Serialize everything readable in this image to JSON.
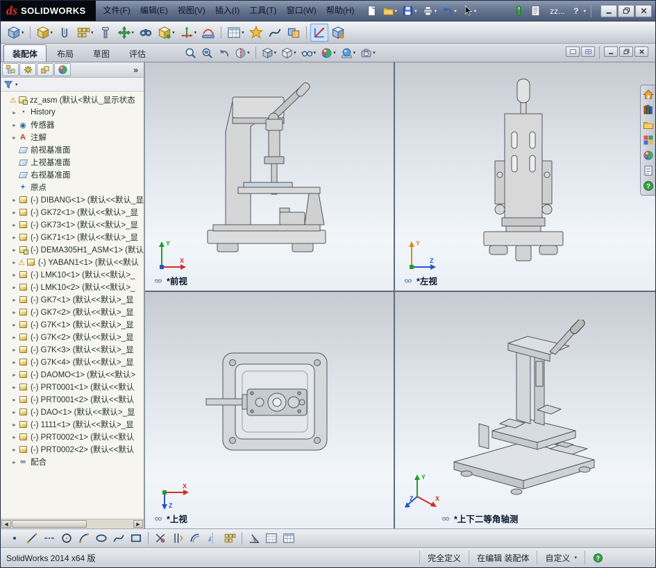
{
  "titlebar": {
    "logo": {
      "ds": "ds",
      "brand": "SOLIDWORKS"
    },
    "menus": [
      "文件(F)",
      "编辑(E)",
      "视图(V)",
      "插入(I)",
      "工具(T)",
      "窗口(W)",
      "帮助(H)"
    ],
    "icons": [
      {
        "n": "new-document-icon",
        "t": "sheet"
      },
      {
        "n": "open-icon",
        "t": "folder",
        "dd": true
      },
      {
        "n": "save-icon",
        "t": "disk",
        "dd": true
      },
      {
        "n": "print-icon",
        "t": "printer",
        "dd": true
      },
      {
        "n": "undo-icon",
        "t": "undo",
        "dd": true
      },
      {
        "n": "select-icon",
        "t": "cursor",
        "dd": true
      }
    ],
    "right_icons": [
      {
        "n": "rebuild-icon",
        "t": "rebuild"
      },
      {
        "n": "file-properties-icon",
        "t": "props"
      }
    ],
    "doc_short": "zz...",
    "help_label": "?",
    "window_buttons": [
      {
        "n": "minimize-icon",
        "t": "winmin"
      },
      {
        "n": "restore-icon",
        "t": "winrestore"
      },
      {
        "n": "close-icon",
        "t": "winclose"
      }
    ]
  },
  "toolbar": {
    "icons": [
      {
        "n": "edit-component-icon",
        "t": "cubeB",
        "dd": true
      },
      {
        "sep": true
      },
      {
        "n": "insert-components-icon",
        "t": "cubeY",
        "dd": true
      },
      {
        "n": "mate-icon",
        "t": "clip"
      },
      {
        "n": "linear-component-pattern-icon",
        "t": "pattern",
        "dd": true
      },
      {
        "n": "smart-fasteners-icon",
        "t": "screw"
      },
      {
        "n": "move-component-icon",
        "t": "move",
        "dd": true
      },
      {
        "n": "show-hidden-components-icon",
        "t": "binoc"
      },
      {
        "n": "assembly-features-icon",
        "t": "cubeY2",
        "dd": true
      },
      {
        "n": "reference-geometry-icon",
        "t": "axis",
        "dd": true
      },
      {
        "n": "new-motion-study-icon",
        "t": "motion"
      },
      {
        "sep": true
      },
      {
        "n": "bill-of-materials-icon",
        "t": "table",
        "dd": true
      },
      {
        "n": "exploded-view-icon",
        "t": "burst"
      },
      {
        "n": "explode-line-sketch-icon",
        "t": "spline"
      },
      {
        "n": "interference-detection-icon",
        "t": "interfere"
      },
      {
        "sep": true
      },
      {
        "n": "instant3d-icon",
        "t": "axis2",
        "active": true
      },
      {
        "n": "large-assembly-mode-icon",
        "t": "cubeB2"
      }
    ]
  },
  "tabs": {
    "items": [
      {
        "name": "tab-assembly",
        "label": "装配体",
        "active": true
      },
      {
        "name": "tab-layout",
        "label": "布局"
      },
      {
        "name": "tab-sketch",
        "label": "草图"
      },
      {
        "name": "tab-evaluate",
        "label": "评估"
      }
    ]
  },
  "headsup": {
    "icons": [
      {
        "n": "zoom-to-fit-icon",
        "t": "magnifier"
      },
      {
        "n": "zoom-to-area-icon",
        "t": "magrect"
      },
      {
        "n": "previous-view-icon",
        "t": "prevview"
      },
      {
        "n": "section-view-icon",
        "t": "section",
        "dd": true
      },
      {
        "sep": true
      },
      {
        "n": "view-orientation-icon",
        "t": "cube",
        "dd": true
      },
      {
        "n": "display-style-icon",
        "t": "cubeW",
        "dd": true
      },
      {
        "n": "hide-show-items-icon",
        "t": "glasses",
        "dd": true
      },
      {
        "n": "edit-appearance-icon",
        "t": "ballcolor",
        "dd": true
      },
      {
        "n": "apply-scene-icon",
        "t": "sceneball",
        "dd": true
      },
      {
        "n": "view-settings-icon",
        "t": "camera",
        "dd": true
      }
    ]
  },
  "docwindow": {
    "buttons": [
      {
        "n": "viewport-layout-single-icon",
        "t": "vp1"
      },
      {
        "n": "viewport-layout-four-icon",
        "t": "vp4"
      },
      {
        "sep": true
      },
      {
        "n": "doc-minimize-icon",
        "t": "winmin"
      },
      {
        "n": "doc-restore-icon",
        "t": "winrestore"
      },
      {
        "n": "doc-close-icon",
        "t": "winclose"
      }
    ]
  },
  "panel": {
    "tabs": [
      {
        "n": "featuremanager-tab-icon",
        "t": "fmtree"
      },
      {
        "n": "propertymanager-tab-icon",
        "t": "pmgear"
      },
      {
        "n": "configurationmanager-tab-icon",
        "t": "config"
      },
      {
        "n": "dimxpert-tab-icon",
        "t": "ballcolor"
      }
    ],
    "chevron": "»",
    "tree": [
      {
        "i": "assembly",
        "l": "zz_asm (默认<默认_显示状态",
        "w": true,
        "root": true
      },
      {
        "i": "history",
        "l": "History",
        "a": true
      },
      {
        "i": "sensors",
        "l": "传感器",
        "a": true
      },
      {
        "i": "annotations",
        "l": "注解",
        "a": true
      },
      {
        "i": "plane",
        "l": "前视基准面"
      },
      {
        "i": "plane",
        "l": "上视基准面"
      },
      {
        "i": "plane",
        "l": "右视基准面"
      },
      {
        "i": "origin",
        "l": "原点"
      },
      {
        "i": "part",
        "l": "(-) DIBANG<1> (默认<<默认_显",
        "a": true
      },
      {
        "i": "part",
        "l": "(-) GK72<1> (默认<<默认>_显",
        "a": true
      },
      {
        "i": "part",
        "l": "(-) GK73<1> (默认<<默认>_显",
        "a": true
      },
      {
        "i": "part",
        "l": "(-) GK71<1> (默认<<默认>_显",
        "a": true
      },
      {
        "i": "assembly",
        "l": "(-) DEMA305H1_ASM<1> (默认",
        "a": true
      },
      {
        "i": "part",
        "l": "(-) YABAN1<1> (默认<<默认",
        "a": true,
        "w": true
      },
      {
        "i": "part",
        "l": "(-) LMK10<1> (默认<<默认>_",
        "a": true
      },
      {
        "i": "part",
        "l": "(-) LMK10<2> (默认<<默认>_",
        "a": true
      },
      {
        "i": "part",
        "l": "(-) GK7<1> (默认<<默认>_显",
        "a": true
      },
      {
        "i": "part",
        "l": "(-) GK7<2> (默认<<默认>_显",
        "a": true
      },
      {
        "i": "part",
        "l": "(-) G7K<1> (默认<<默认>_显",
        "a": true
      },
      {
        "i": "part",
        "l": "(-) G7K<2> (默认<<默认>_显",
        "a": true
      },
      {
        "i": "part",
        "l": "(-) G7K<3> (默认<<默认>_显",
        "a": true
      },
      {
        "i": "part",
        "l": "(-) G7K<4> (默认<<默认>_显",
        "a": true
      },
      {
        "i": "part",
        "l": "(-) DAOMO<1> (默认<<默认>",
        "a": true
      },
      {
        "i": "part",
        "l": "(-) PRT0001<1> (默认<<默认",
        "a": true
      },
      {
        "i": "part",
        "l": "(-) PRT0001<2> (默认<<默认",
        "a": true
      },
      {
        "i": "part",
        "l": "(-) DAO<1> (默认<<默认>_显",
        "a": true
      },
      {
        "i": "part",
        "l": "(-) 1111<1> (默认<<默认>_显",
        "a": true
      },
      {
        "i": "part",
        "l": "(-) PRT0002<1> (默认<<默认",
        "a": true
      },
      {
        "i": "part",
        "l": "(-) PRT0002<2> (默认<<默认",
        "a": true
      },
      {
        "i": "mates",
        "l": "配合",
        "a": true
      }
    ]
  },
  "viewports": [
    {
      "label": "*前视"
    },
    {
      "label": "*左视"
    },
    {
      "label": "*上视"
    },
    {
      "label": "*上下二等角轴测"
    }
  ],
  "taskpane": {
    "icons": [
      {
        "n": "solidworks-resources-icon",
        "t": "home"
      },
      {
        "n": "design-library-icon",
        "t": "books"
      },
      {
        "n": "file-explorer-icon",
        "t": "folder"
      },
      {
        "n": "view-palette-icon",
        "t": "palette"
      },
      {
        "n": "appearances-icon",
        "t": "ballcolor"
      },
      {
        "n": "custom-properties-icon",
        "t": "props"
      },
      {
        "n": "forum-icon",
        "t": "question"
      }
    ]
  },
  "sketchbar": {
    "icons": [
      {
        "n": "sketch-point-icon",
        "t": "point"
      },
      {
        "n": "line-icon",
        "t": "line"
      },
      {
        "n": "centerline-icon",
        "t": "centerline"
      },
      {
        "n": "circle-icon",
        "t": "circle"
      },
      {
        "n": "arc-icon",
        "t": "arc"
      },
      {
        "n": "ellipse-icon",
        "t": "ellipse"
      },
      {
        "n": "spline-icon",
        "t": "spline"
      },
      {
        "n": "rectangle-icon",
        "t": "rect"
      },
      {
        "sep": true
      },
      {
        "n": "trim-entities-icon",
        "t": "trim"
      },
      {
        "n": "convert-entities-icon",
        "t": "convert"
      },
      {
        "n": "offset-entities-icon",
        "t": "offset"
      },
      {
        "n": "mirror-entities-icon",
        "t": "mirror"
      },
      {
        "n": "linear-sketch-pattern-icon",
        "t": "pattern"
      },
      {
        "sep": true
      },
      {
        "n": "smart-dimension-icon",
        "t": "angle"
      },
      {
        "n": "grid-snap-icon",
        "t": "grid"
      },
      {
        "n": "quick-snaps-icon",
        "t": "table"
      }
    ]
  },
  "statusbar": {
    "app": "SolidWorks 2014 x64 版",
    "defined": "完全定义",
    "editing": "在编辑 装配体",
    "custom": "自定义"
  }
}
